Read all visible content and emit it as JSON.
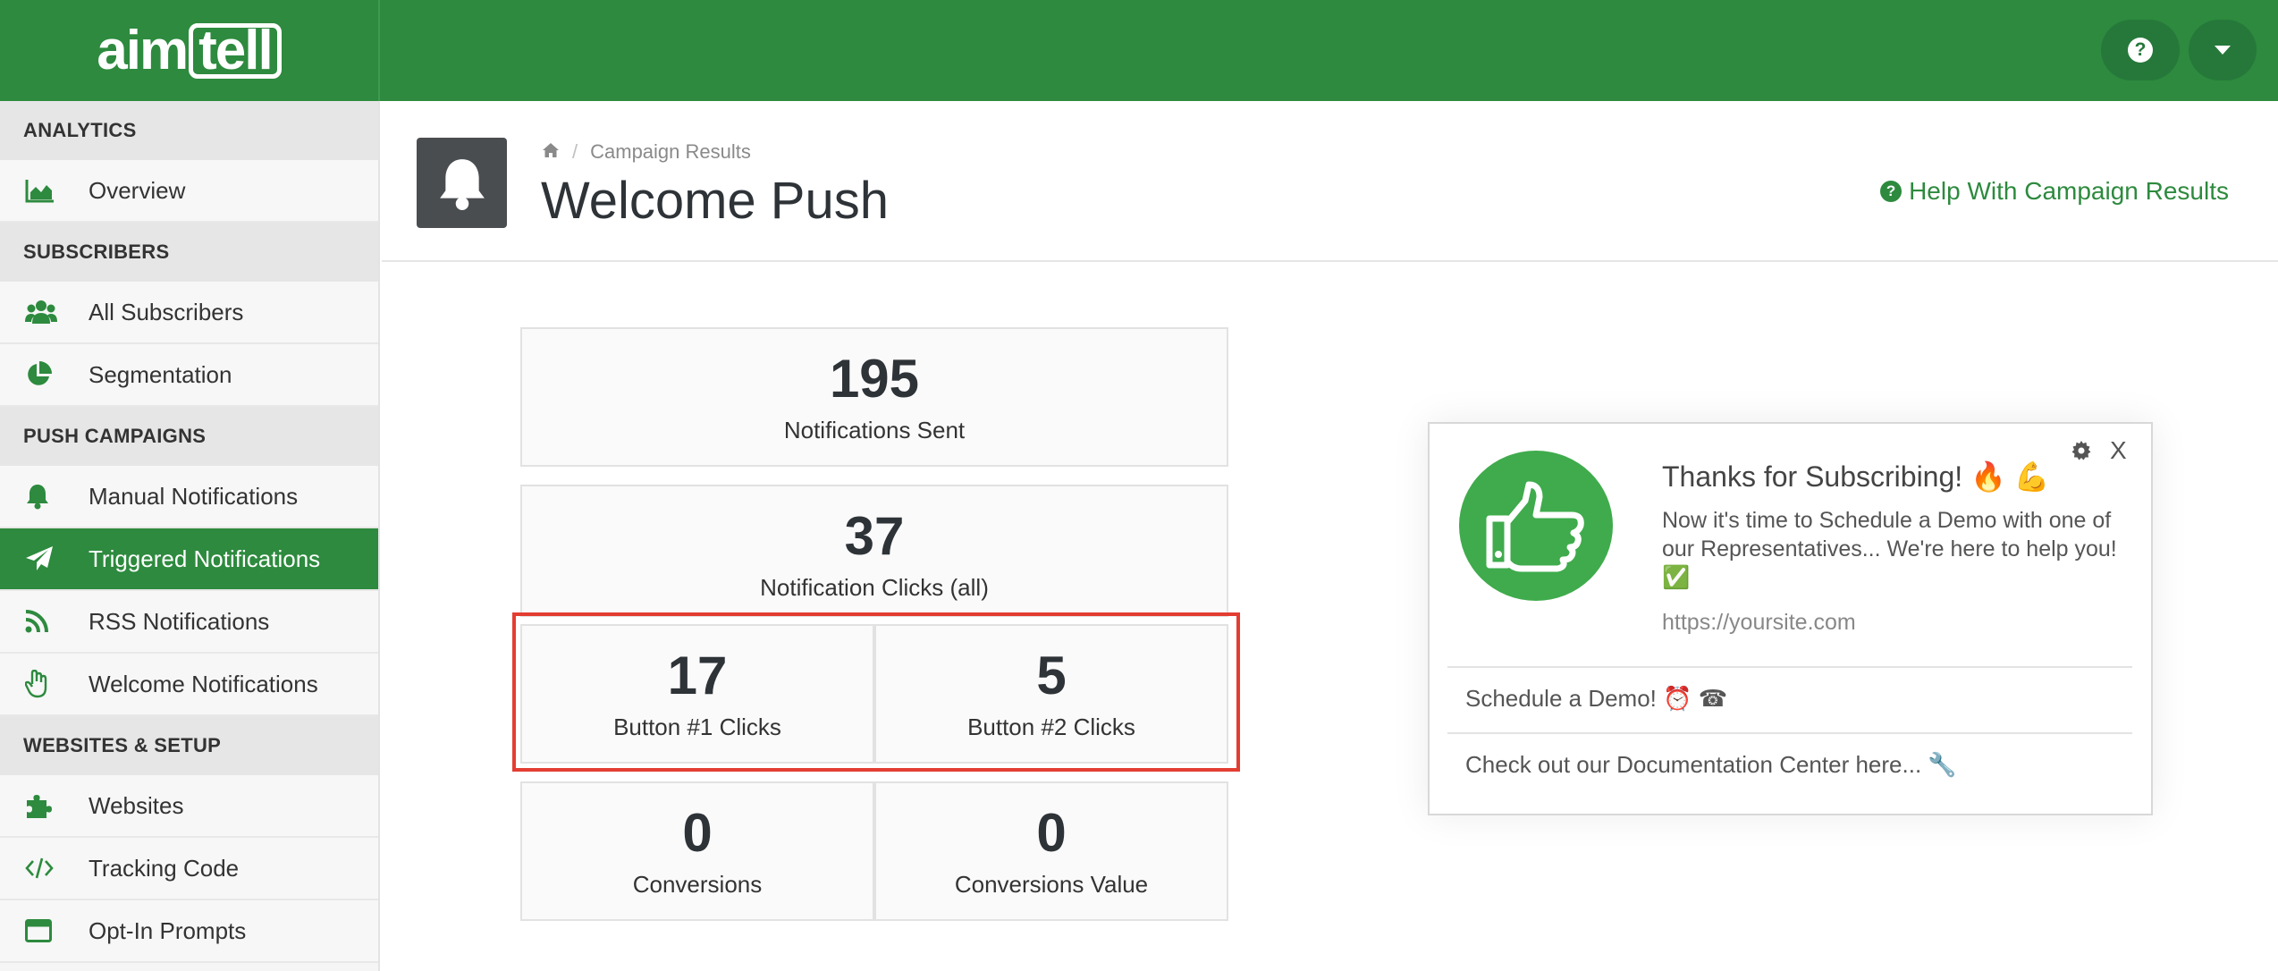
{
  "app": {
    "logo_prefix": "aim",
    "logo_suffix": "tell"
  },
  "topbar": {
    "help_icon": "question-circle-icon",
    "dropdown_icon": "caret-down-icon"
  },
  "sidebar": {
    "sections": [
      {
        "header": "ANALYTICS",
        "items": [
          {
            "label": "Overview",
            "icon": "area-chart-icon"
          }
        ]
      },
      {
        "header": "SUBSCRIBERS",
        "items": [
          {
            "label": "All Subscribers",
            "icon": "users-icon"
          },
          {
            "label": "Segmentation",
            "icon": "pie-chart-icon"
          }
        ]
      },
      {
        "header": "PUSH CAMPAIGNS",
        "items": [
          {
            "label": "Manual Notifications",
            "icon": "bell-icon"
          },
          {
            "label": "Triggered Notifications",
            "icon": "paper-plane-icon",
            "active": true
          },
          {
            "label": "RSS Notifications",
            "icon": "rss-icon"
          },
          {
            "label": "Welcome Notifications",
            "icon": "waving-hand-icon"
          }
        ]
      },
      {
        "header": "WEBSITES & SETUP",
        "items": [
          {
            "label": "Websites",
            "icon": "puzzle-icon"
          },
          {
            "label": "Tracking Code",
            "icon": "code-icon"
          },
          {
            "label": "Opt-In Prompts",
            "icon": "window-icon"
          }
        ]
      }
    ]
  },
  "header": {
    "breadcrumb": "Campaign Results",
    "title": "Welcome Push",
    "help_link": "Help With Campaign Results"
  },
  "stats": {
    "sent": {
      "value": "195",
      "label": "Notifications Sent"
    },
    "clicks": {
      "value": "37",
      "label": "Notification Clicks (all)"
    },
    "button1": {
      "value": "17",
      "label": "Button #1 Clicks"
    },
    "button2": {
      "value": "5",
      "label": "Button #2 Clicks"
    },
    "conversions": {
      "value": "0",
      "label": "Conversions"
    },
    "conversions_value": {
      "value": "0",
      "label": "Conversions Value"
    }
  },
  "preview": {
    "title": "Thanks for Subscribing! 🔥 💪",
    "body": "Now it's time to Schedule a Demo with one of our Representatives... We're here to help you! ✅",
    "url": "https://yoursite.com",
    "close": "X",
    "button1": "Schedule a Demo! ⏰ ☎",
    "button2": "Check out our Documentation Center here... 🔧"
  },
  "colors": {
    "brand": "#2d8a3e",
    "highlight": "#e33d32"
  }
}
